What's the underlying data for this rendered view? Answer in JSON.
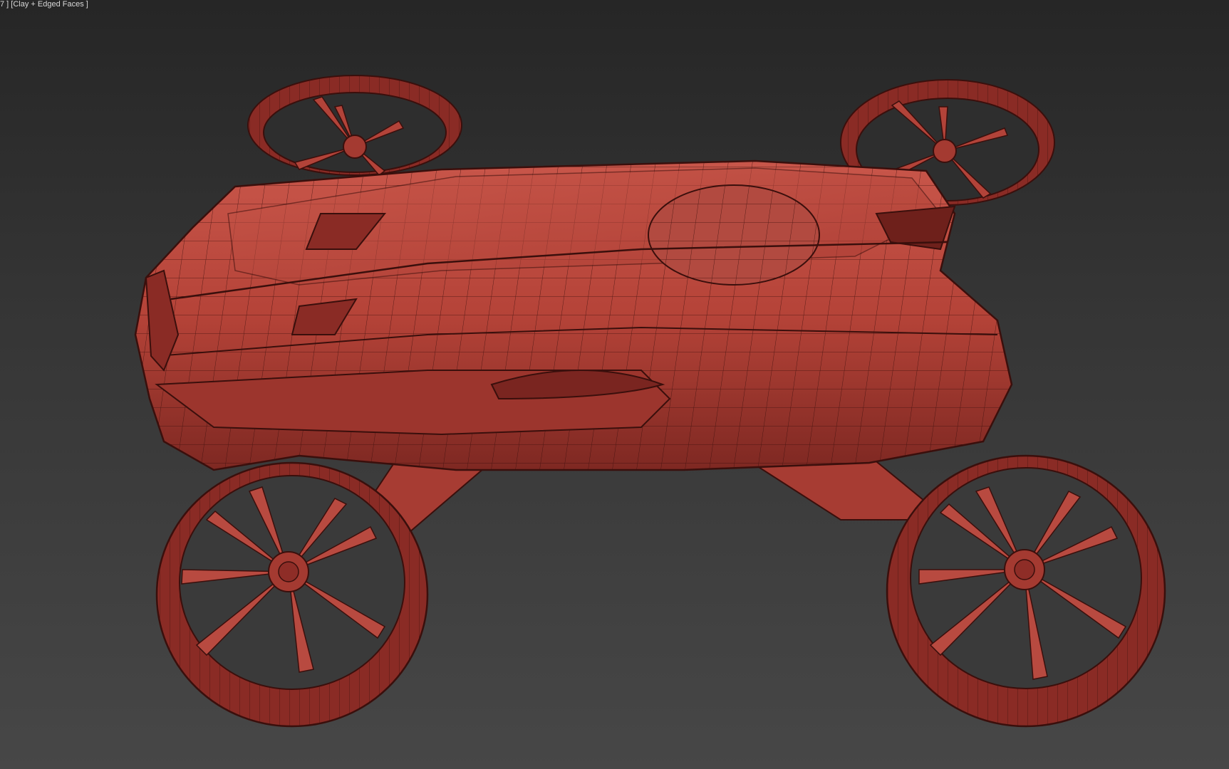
{
  "viewport": {
    "label": "7 ] [Clay + Edged Faces ]",
    "background_top": "#262626",
    "background_bottom": "#474747"
  },
  "model": {
    "clay_color": "#b8453c",
    "clay_dark": "#7a2520",
    "clay_light": "#d36a5c",
    "edge_color": "#3a0f0c",
    "icon": "flying-car-model-icon"
  }
}
